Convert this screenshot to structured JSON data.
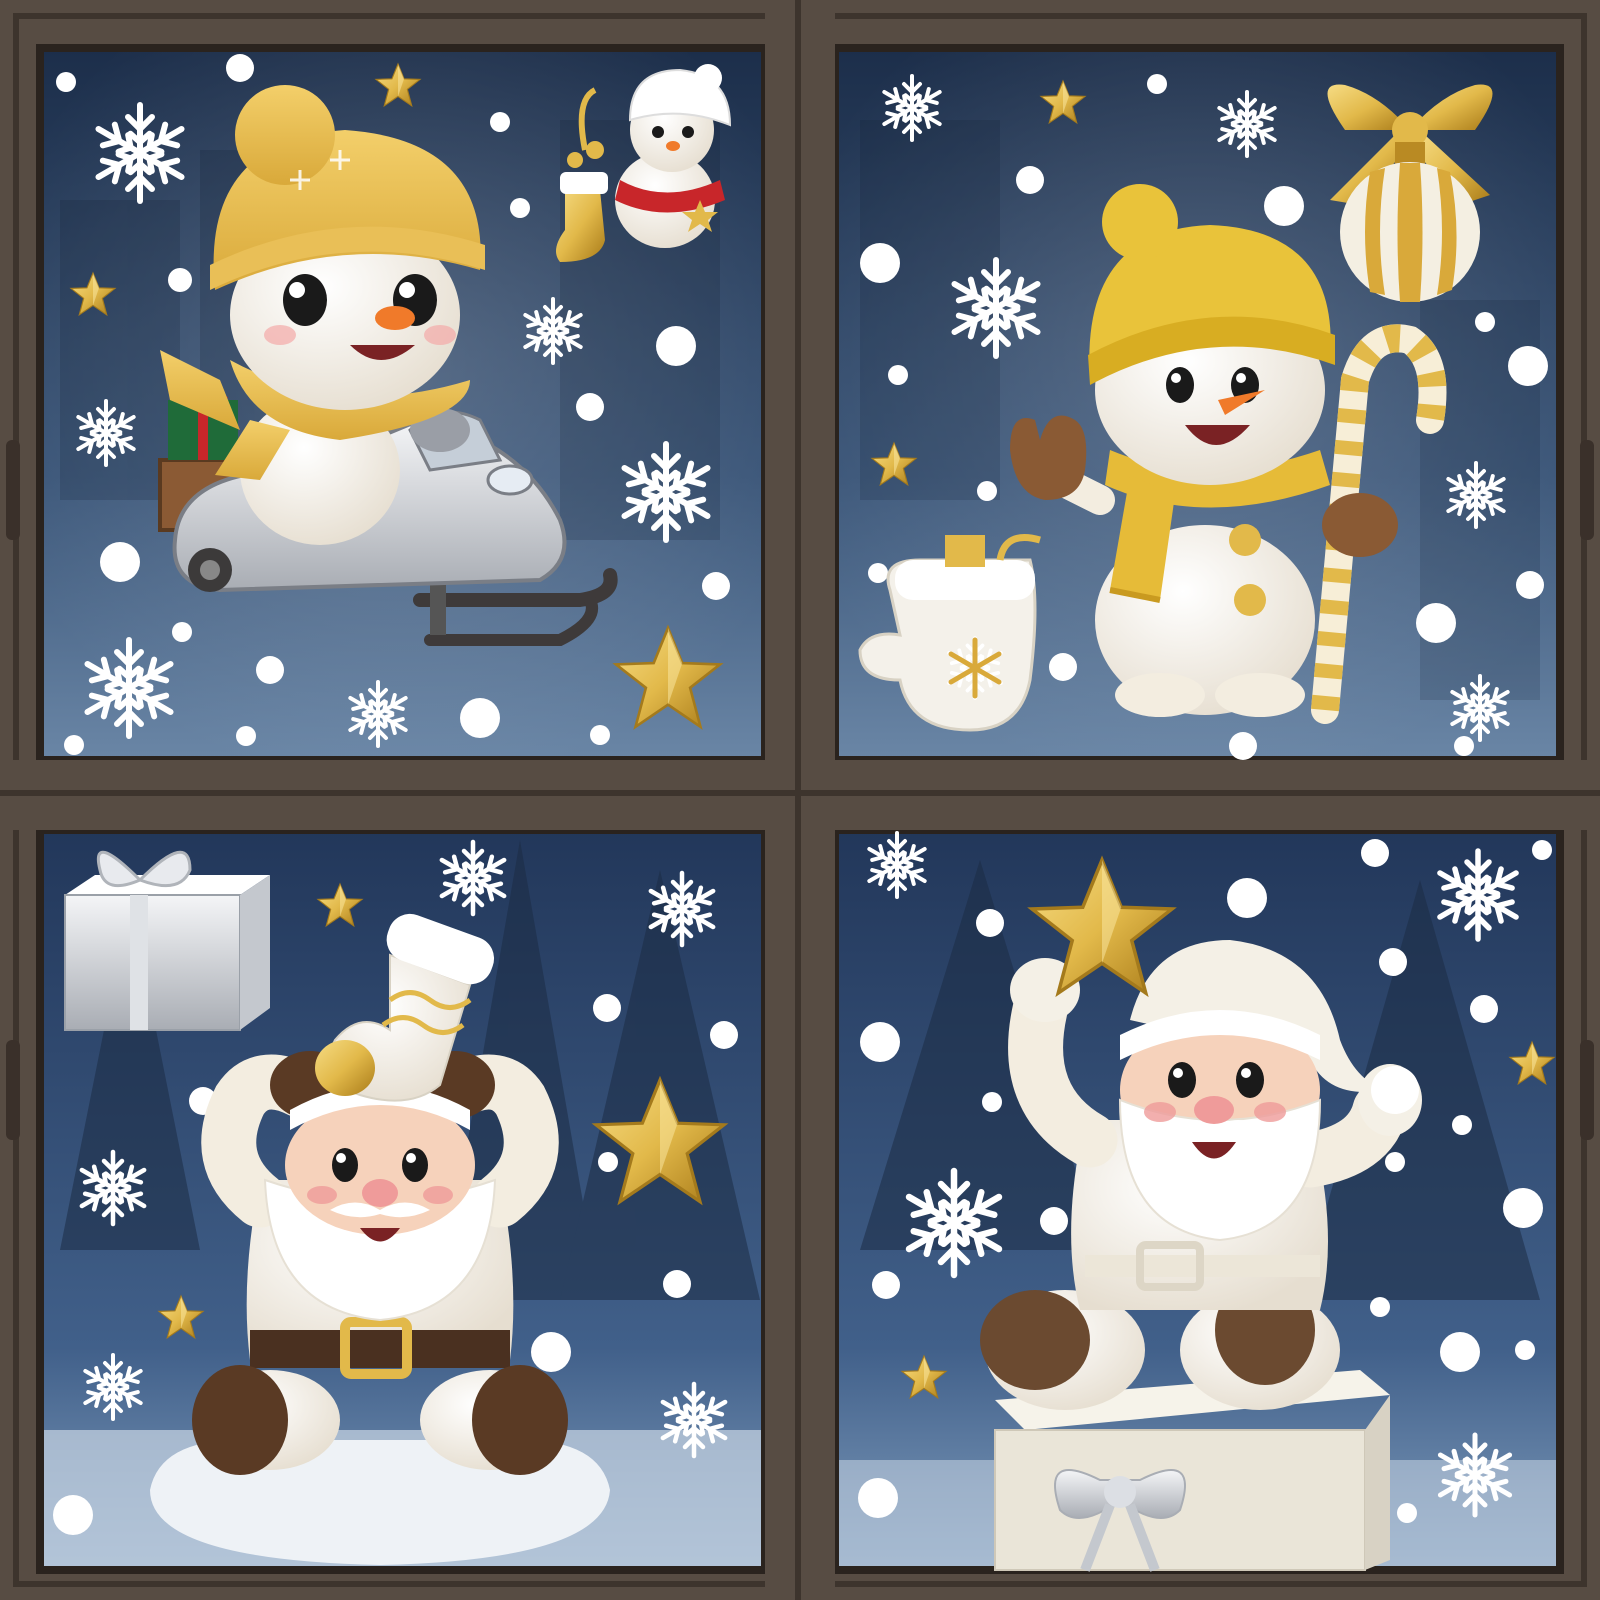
{
  "scene": {
    "subject": "window-with-christmas-decals",
    "panes": [
      {
        "id": "top-left",
        "character": "snowman-on-snowmobile"
      },
      {
        "id": "top-right",
        "character": "snowman-with-candy-cane"
      },
      {
        "id": "bottom-left",
        "character": "santa-holding-stocking"
      },
      {
        "id": "bottom-right",
        "character": "santa-on-gift-holding-star"
      }
    ],
    "colors": {
      "frame": "#5b5048",
      "frame_dark": "#3d342d",
      "sky_top": "#1f3350",
      "sky_bottom": "#5e7a9a",
      "gold": "#e2b94a",
      "gold_dark": "#b98a23",
      "cream": "#f5f0e6",
      "brown": "#5a3a24",
      "skin": "#f4c9b0",
      "red": "#c8262a"
    },
    "icons": [
      "snowflake-icon",
      "star-icon",
      "snow-dot",
      "gift-icon",
      "ornament-icon",
      "stocking-icon",
      "mitten-icon",
      "candy-cane-icon"
    ]
  }
}
